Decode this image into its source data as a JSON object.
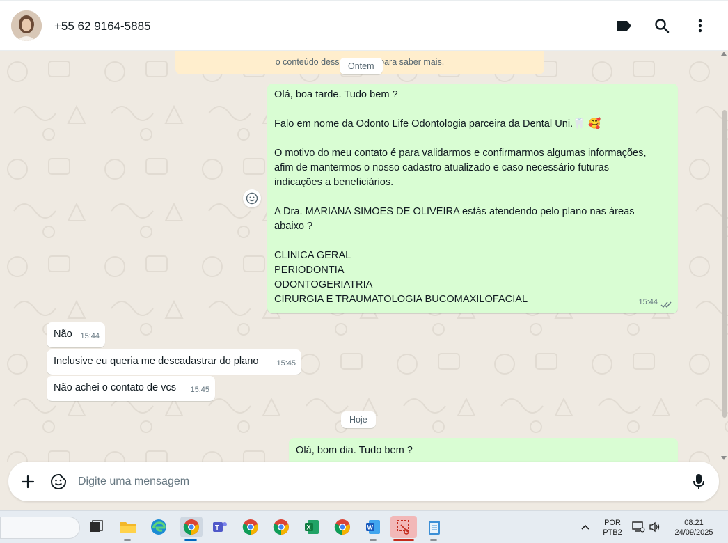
{
  "header": {
    "contact_name": "+55 62 9164-5885",
    "icons": [
      "label-icon",
      "search-icon",
      "menu-icon"
    ]
  },
  "chat": {
    "encryption_notice_tail": "o conteúdo dessas co               que para saber mais.",
    "date_yesterday": "Ontem",
    "date_today": "Hoje",
    "messages": [
      {
        "direction": "outgoing",
        "lines": [
          "Olá, boa tarde. Tudo bem ?",
          "",
          "Falo em nome da Odonto Life Odontologia parceira da Dental Uni.🦷 🥰",
          "",
          "O motivo do meu contato é para validarmos e confirmarmos algumas informações,",
          "afim de mantermos o nosso cadastro atualizado e caso necessário futuras",
          "indicações a beneficiários.",
          "",
          "A Dra. MARIANA SIMOES DE OLIVEIRA estás atendendo pelo plano nas áreas",
          "abaixo ?",
          "",
          "CLINICA GERAL",
          "PERIODONTIA",
          "ODONTOGERIATRIA",
          "CIRURGIA E TRAUMATOLOGIA BUCOMAXILOFACIAL"
        ],
        "time": "15:44",
        "status": "read"
      },
      {
        "direction": "incoming",
        "text": "Não",
        "time": "15:44"
      },
      {
        "direction": "incoming",
        "text": "Inclusive eu queria me descadastrar do plano",
        "time": "15:45"
      },
      {
        "direction": "incoming",
        "text": "Não achei o contato de vcs",
        "time": "15:45"
      },
      {
        "direction": "outgoing",
        "text": "Olá, bom dia. Tudo bem ?",
        "time": ""
      }
    ]
  },
  "composer": {
    "placeholder": "Digite uma mensagem",
    "icons": [
      "plus-icon",
      "sticker-icon",
      "microphone-icon"
    ]
  },
  "taskbar": {
    "language_top": "POR",
    "language_bottom": "PTB2",
    "time": "08:21",
    "date": "24/09/2025"
  },
  "colors": {
    "outgoing_bubble": "#d9fdd3",
    "incoming_bubble": "#ffffff",
    "chat_background": "#efeae2",
    "encryption_notice": "#ffeecd",
    "read_ticks": "#667781"
  }
}
